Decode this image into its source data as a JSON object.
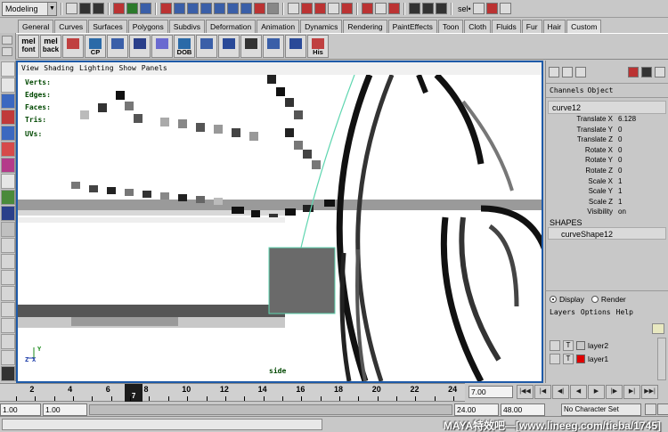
{
  "status_line": {
    "mode": "Modeling",
    "selection_label": "sel•"
  },
  "shelf": {
    "tabs": [
      "General",
      "Curves",
      "Surfaces",
      "Polygons",
      "Subdivs",
      "Deformation",
      "Animation",
      "Dynamics",
      "Rendering",
      "PaintEffects",
      "Toon",
      "Cloth",
      "Fluids",
      "Fur",
      "Hair",
      "Custom"
    ],
    "active_tab": "Custom",
    "buttons": [
      {
        "name": "mel-font-button",
        "line1": "mel",
        "line2": "font"
      },
      {
        "name": "mel-back-button",
        "line1": "mel",
        "line2": "back"
      },
      {
        "name": "xyz-button",
        "caption": ""
      },
      {
        "name": "cp-button",
        "caption": "CP"
      },
      {
        "name": "cube-tool-button",
        "caption": ""
      },
      {
        "name": "cylinder-tool-button",
        "caption": ""
      },
      {
        "name": "rotate-tool-button",
        "caption": ""
      },
      {
        "name": "dob-button",
        "caption": "DOB"
      },
      {
        "name": "grid-tool-button",
        "caption": ""
      },
      {
        "name": "plane-tool-button",
        "caption": ""
      },
      {
        "name": "cube-select-button",
        "caption": ""
      },
      {
        "name": "shape-tool-button",
        "caption": ""
      },
      {
        "name": "bars-tool-button",
        "caption": ""
      },
      {
        "name": "his-button",
        "caption": "His"
      }
    ]
  },
  "viewport": {
    "menu": [
      "View",
      "Shading",
      "Lighting",
      "Show",
      "Panels"
    ],
    "hud": {
      "verts": "Verts:",
      "edges": "Edges:",
      "faces": "Faces:",
      "tris": "Tris:",
      "uvs": "UVs:"
    },
    "camera_name": "side",
    "axis_y": "Y",
    "axis_z": "Z",
    "axis_x": "X"
  },
  "channel_box": {
    "tabs": [
      "Channels",
      "Object"
    ],
    "object_name": "curve12",
    "attributes": [
      {
        "name": "Translate X",
        "value": "6.128"
      },
      {
        "name": "Translate Y",
        "value": "0"
      },
      {
        "name": "Translate Z",
        "value": "0"
      },
      {
        "name": "Rotate X",
        "value": "0"
      },
      {
        "name": "Rotate Y",
        "value": "0"
      },
      {
        "name": "Rotate Z",
        "value": "0"
      },
      {
        "name": "Scale X",
        "value": "1"
      },
      {
        "name": "Scale Y",
        "value": "1"
      },
      {
        "name": "Scale Z",
        "value": "1"
      },
      {
        "name": "Visibility",
        "value": "on"
      }
    ],
    "shapes_title": "SHAPES",
    "shape_name": "curveShape12"
  },
  "layer_editor": {
    "modes": [
      "Display",
      "Render"
    ],
    "active_mode": "Display",
    "menu": [
      "Layers",
      "Options",
      "Help"
    ],
    "layers": [
      {
        "name": "layer2",
        "t": "T",
        "color": "#c8c8c8"
      },
      {
        "name": "layer1",
        "t": "T",
        "color": "#e00000"
      }
    ]
  },
  "time_slider": {
    "ticks": [
      "2",
      "4",
      "6",
      "8",
      "10",
      "12",
      "14",
      "16",
      "18",
      "20",
      "22",
      "24"
    ],
    "current_frame": "7",
    "current_frame_field": "7.00"
  },
  "range_slider": {
    "start_time": "1.00",
    "playback_start": "1.00",
    "playback_end": "24.00",
    "end_time": "48.00",
    "character_set": "No Character Set"
  },
  "command_line": {
    "watermark": "MAYA特效吧—[www.lineeg.com/tieba/1745]"
  },
  "colors": {
    "viewport_border": "#1e5aa8",
    "curve": "#5fd6b0",
    "selected_box": "#6a6a6a"
  }
}
